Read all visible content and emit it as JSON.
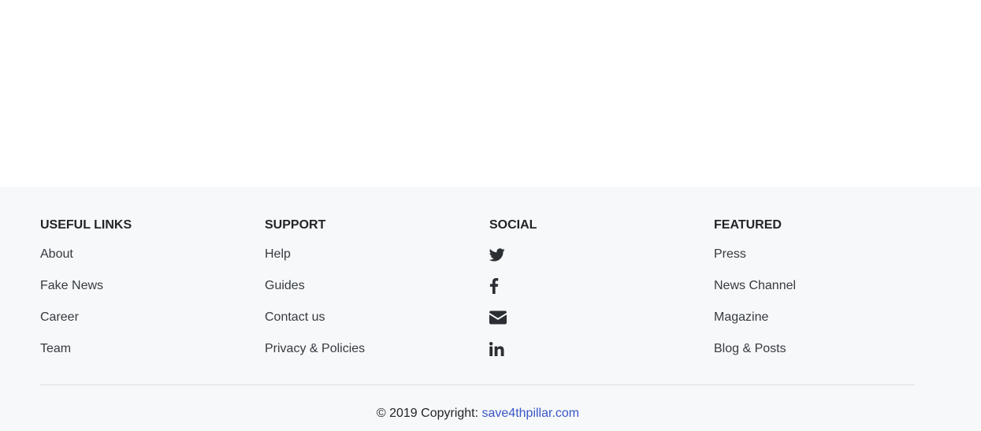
{
  "footer": {
    "columns": [
      {
        "heading": "USEFUL LINKS",
        "links": [
          "About",
          "Fake News",
          "Career",
          "Team"
        ]
      },
      {
        "heading": "SUPPORT",
        "links": [
          "Help",
          "Guides",
          "Contact us",
          "Privacy & Policies"
        ]
      },
      {
        "heading": "SOCIAL",
        "icons": [
          "twitter-icon",
          "facebook-icon",
          "envelope-icon",
          "linkedin-icon"
        ]
      },
      {
        "heading": "FEATURED",
        "links": [
          "Press",
          "News Channel",
          "Magazine",
          "Blog & Posts"
        ]
      }
    ],
    "copyright_prefix": "© 2019 Copyright: ",
    "copyright_link": "save4thpillar.com"
  },
  "colors": {
    "footer_bg": "#f7f8f9",
    "link_accent": "#3a56c8",
    "text": "#343a40"
  }
}
